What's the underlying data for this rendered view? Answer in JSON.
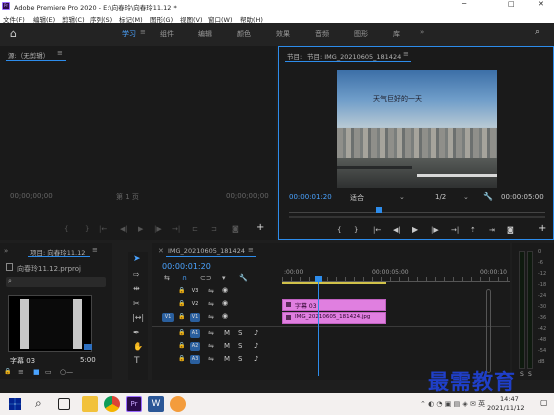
{
  "window": {
    "title": "Adobe Premiere Pro 2020 - E:\\向春玲\\向春玲11.12 *",
    "app_icon": "Pr"
  },
  "menu": [
    "文件(F)",
    "编辑(E)",
    "剪辑(C)",
    "序列(S)",
    "标记(M)",
    "图形(G)",
    "视图(V)",
    "窗口(W)",
    "帮助(H)"
  ],
  "workspace": {
    "tabs": [
      "学习",
      "组件",
      "编辑",
      "颜色",
      "效果",
      "音频",
      "图形",
      "库"
    ],
    "active": "学习"
  },
  "source": {
    "title": "源:（无剪辑）",
    "tc_left": "00;00;00;00",
    "tc_right": "00;00;00;00",
    "page": "第 1 页"
  },
  "program": {
    "title": "节目: IMG_20210605_181424",
    "caption": "天气巨好的一天",
    "timecode": "00:00:01:20",
    "fit": "适合",
    "resolution": "1/2",
    "duration": "00:00:05:00"
  },
  "project": {
    "title": "项目: 向春玲11.12",
    "file": "向春玲11.12.prproj",
    "item": "字幕 03",
    "item_duration": "5:00"
  },
  "timeline": {
    "title": "IMG_20210605_181424",
    "timecode": "00:00:01:20",
    "ruler": [
      ":00:00",
      "00:00:05:00",
      "00:00:10"
    ],
    "video_tracks": [
      "V3",
      "V2",
      "V1"
    ],
    "audio_tracks": [
      "A1",
      "A2",
      "A3"
    ],
    "source_patch": "V1",
    "clips": [
      {
        "name": "字幕 03",
        "track": "V2"
      },
      {
        "name": "IMG_20210605_181424.jpg",
        "track": "V1"
      }
    ],
    "playhead_fraction": 0.18
  },
  "meters": {
    "labels": [
      "0",
      "-6",
      "-12",
      "-18",
      "-24",
      "-30",
      "-36",
      "-42",
      "-48",
      "-54",
      "dB"
    ]
  },
  "watermark": "最需教育",
  "taskbar": {
    "time": "14:47",
    "date": "2021/11/12"
  }
}
